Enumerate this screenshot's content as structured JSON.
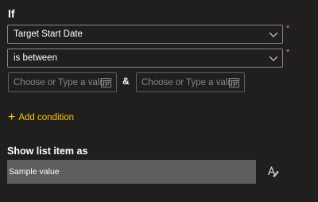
{
  "heading_if": "If",
  "condition": {
    "field_value": "Target Start Date",
    "operator_value": "is between",
    "required_marker": "*",
    "date_from": {
      "placeholder": "Choose or Type a value"
    },
    "join_symbol": "&",
    "date_to": {
      "placeholder": "Choose or Type a value"
    }
  },
  "add_condition": {
    "plus": "+",
    "label": "Add condition"
  },
  "show_as": {
    "heading": "Show list item as",
    "sample_text": "Sample value"
  },
  "icons": {
    "chevron": "chevron-down-icon",
    "calendar": "calendar-icon",
    "edit_style": "text-style-brush-icon"
  },
  "colors": {
    "background": "#201f1e",
    "accent": "#f5c518",
    "required": "#f1707b",
    "sample_bg": "#605e5c"
  }
}
